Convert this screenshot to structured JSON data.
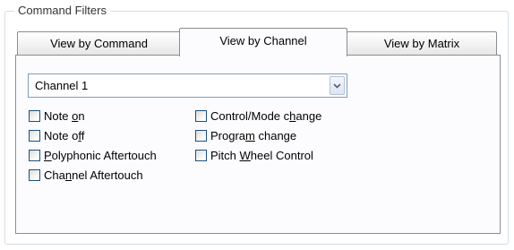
{
  "group": {
    "title": "Command Filters"
  },
  "tabs": [
    {
      "label": "View by Command",
      "active": false
    },
    {
      "label": "View by Channel",
      "active": true
    },
    {
      "label": "View by Matrix",
      "active": false
    }
  ],
  "channel_select": {
    "value": "Channel 1",
    "icon": "chevron-down-icon"
  },
  "checkboxes": {
    "note_on": {
      "pre": "Note ",
      "key": "o",
      "post": "n",
      "checked": false
    },
    "note_off": {
      "pre": "Note o",
      "key": "f",
      "post": "f",
      "checked": false
    },
    "poly_aftertouch": {
      "pre": "",
      "key": "P",
      "post": "olyphonic Aftertouch",
      "checked": false
    },
    "channel_aftertouch": {
      "pre": "Cha",
      "key": "n",
      "post": "nel Aftertouch",
      "checked": false
    },
    "control_mode_change": {
      "pre": "Control/Mode c",
      "key": "h",
      "post": "ange",
      "checked": false
    },
    "program_change": {
      "pre": "Progra",
      "key": "m",
      "post": " change",
      "checked": false
    },
    "pitch_wheel_control": {
      "pre": "Pitch ",
      "key": "W",
      "post": "heel Control",
      "checked": false
    }
  },
  "colors": {
    "tab_border": "#8c8d8f",
    "checkbox_border": "#1c5180",
    "combo_border": "#7f9db9"
  }
}
